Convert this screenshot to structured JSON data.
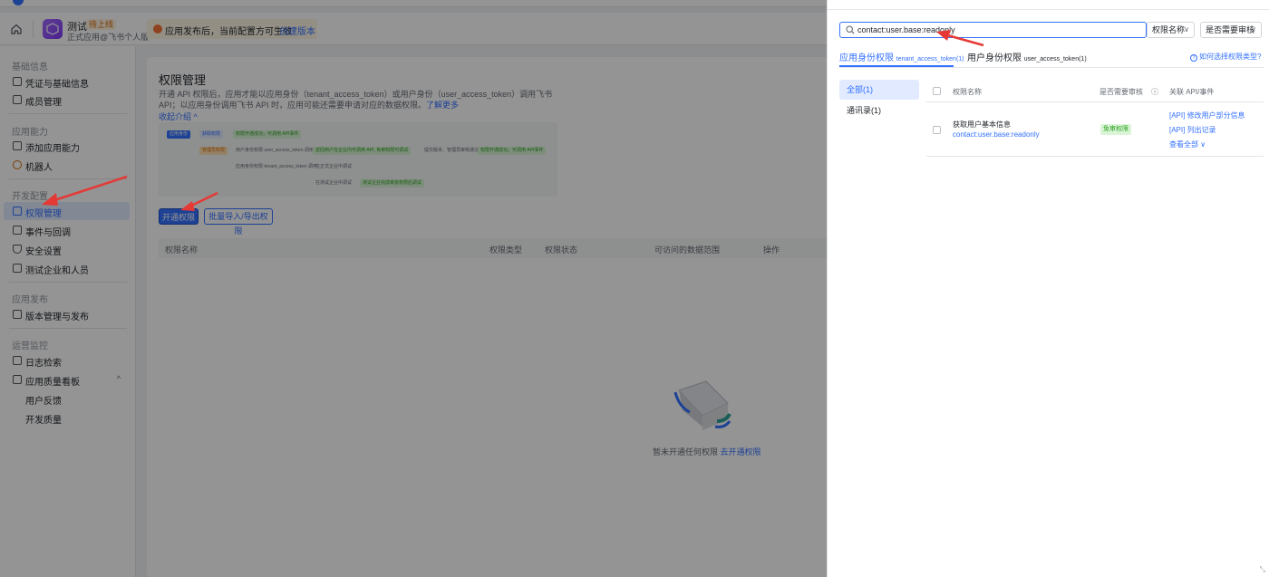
{
  "header": {
    "app_name": "测试",
    "app_badge": "待上线",
    "app_sub": "正式应用@飞书个人版",
    "notice_text": "应用发布后，当前配置方可生效",
    "notice_link": "创建版本"
  },
  "sidebar": {
    "groups": [
      "基础信息",
      "应用能力",
      "开发配置",
      "应用发布",
      "运营监控"
    ],
    "items": [
      {
        "label": "凭证与基础信息"
      },
      {
        "label": "成员管理"
      },
      {
        "label": "添加应用能力"
      },
      {
        "label": "机器人"
      },
      {
        "label": "权限管理"
      },
      {
        "label": "事件与回调"
      },
      {
        "label": "安全设置"
      },
      {
        "label": "测试企业和人员"
      },
      {
        "label": "版本管理与发布"
      },
      {
        "label": "日志检索"
      },
      {
        "label": "应用质量看板"
      },
      {
        "label": "用户反馈"
      },
      {
        "label": "开发质量"
      }
    ]
  },
  "main": {
    "title": "权限管理",
    "desc": "开通 API 权限后，应用才能以应用身份（tenant_access_token）或用户身份（user_access_token）调用飞书 API；以应用身份调用飞书 API 时，应用可能还需要申请对应的数据权限。",
    "learn_more": "了解更多",
    "collapse": "收起介绍",
    "flow": {
      "row1": [
        "应用身份",
        "获取权限",
        "权限开通成功，可调用 API事件"
      ],
      "row2": [
        "管理员权限",
        "用户身份权限 user_access_token 调用",
        "返回用户在企业内可调用 API, 免审权限可调试",
        "提交版本、管理员审核通过",
        "权限开通成功，可调用 API事件"
      ],
      "row3": [
        "应用身份权限 tenant_access_token 调用",
        "在正式企业中调试"
      ],
      "row4": [
        "在测试企业中调试",
        "测试企业完成审批权限后调试"
      ]
    },
    "btn_open": "开通权限",
    "btn_batch": "批量导入/导出权限",
    "table_headers": [
      "权限名称",
      "权限类型",
      "权限状态",
      "可访问的数据范围",
      "操作"
    ],
    "empty_text": "暂未开通任何权限",
    "empty_link": "去开通权限"
  },
  "drawer": {
    "search_value": "contact:user.base:readonly",
    "select_name": "权限名称",
    "select_review": "是否需要审核",
    "tab_app": "应用身份权限",
    "tab_app_token": "tenant_access_token(1)",
    "tab_user": "用户身份权限",
    "tab_user_token": "user_access_token(1)",
    "help_link": "如何选择权限类型?",
    "categories": [
      "全部(1)",
      "通讯录(1)"
    ],
    "headers": [
      "权限名称",
      "是否需要审核",
      "关联 API/事件"
    ],
    "row": {
      "name": "获取用户基本信息",
      "code": "contact:user.base:readonly",
      "tag": "免审权限",
      "apis": [
        "[API] 修改用户部分信息",
        "[API] 列出记录"
      ],
      "see_all": "查看全部"
    }
  }
}
